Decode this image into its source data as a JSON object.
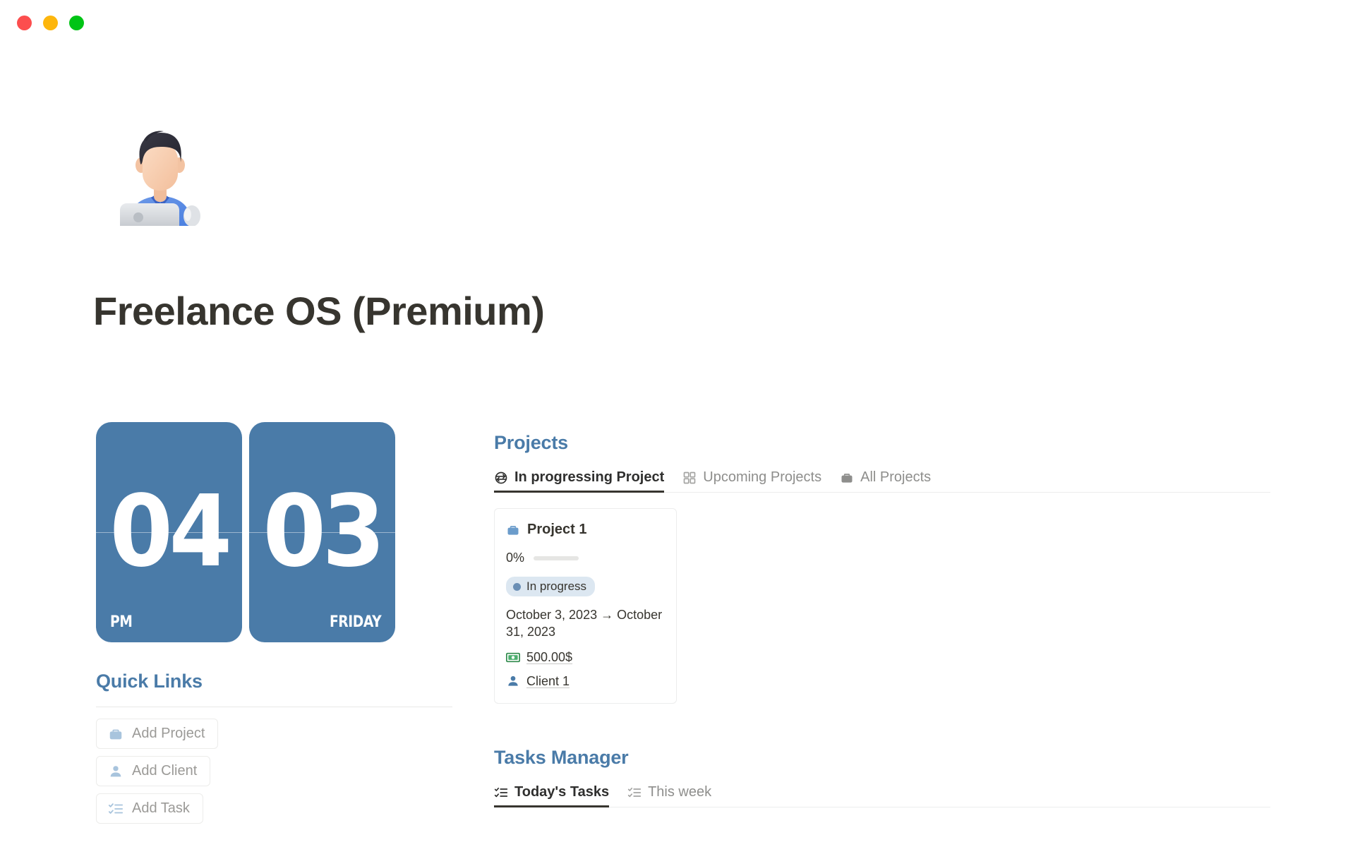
{
  "window": {
    "controls": [
      {
        "name": "close",
        "color": "#fc4e4e"
      },
      {
        "name": "minimize",
        "color": "#fdb60d"
      },
      {
        "name": "maximize",
        "color": "#00c415"
      }
    ]
  },
  "header": {
    "avatar_icon": "person-with-laptop-illustration",
    "title": "Freelance OS (Premium)"
  },
  "clock": {
    "hour": "04",
    "meridiem": "PM",
    "day_number": "03",
    "weekday": "FRIDAY",
    "card_color": "#4a7ba8"
  },
  "quick_links": {
    "heading": "Quick Links",
    "buttons": [
      {
        "label": "Add Project",
        "icon": "briefcase-icon"
      },
      {
        "label": "Add Client",
        "icon": "person-icon"
      },
      {
        "label": "Add Task",
        "icon": "checklist-icon"
      }
    ]
  },
  "projects": {
    "heading": "Projects",
    "tabs": [
      {
        "label": "In progressing Project",
        "icon": "sync-arrows-icon",
        "active": true
      },
      {
        "label": "Upcoming Projects",
        "icon": "grid-icon",
        "active": false
      },
      {
        "label": "All Projects",
        "icon": "briefcase-icon",
        "active": false
      }
    ],
    "cards": [
      {
        "title": "Project 1",
        "title_icon": "briefcase-icon",
        "progress_pct": "0%",
        "progress_value": 0,
        "status": "In progress",
        "status_bg": "#dce7f1",
        "status_dot": "#6b8fb5",
        "dates": "October 3, 2023 → October 31, 2023",
        "amount": "500.00$",
        "amount_icon": "money-icon",
        "client": "Client 1",
        "client_icon": "person-icon"
      }
    ]
  },
  "tasks": {
    "heading": "Tasks Manager",
    "tabs": [
      {
        "label": "Today's Tasks",
        "icon": "checklist-icon",
        "active": true
      },
      {
        "label": "This week",
        "icon": "checklist-icon",
        "active": false
      }
    ]
  },
  "theme": {
    "accent_blue": "#4a7ba8",
    "text_dark": "#37352f",
    "text_muted": "#9b9a97"
  }
}
